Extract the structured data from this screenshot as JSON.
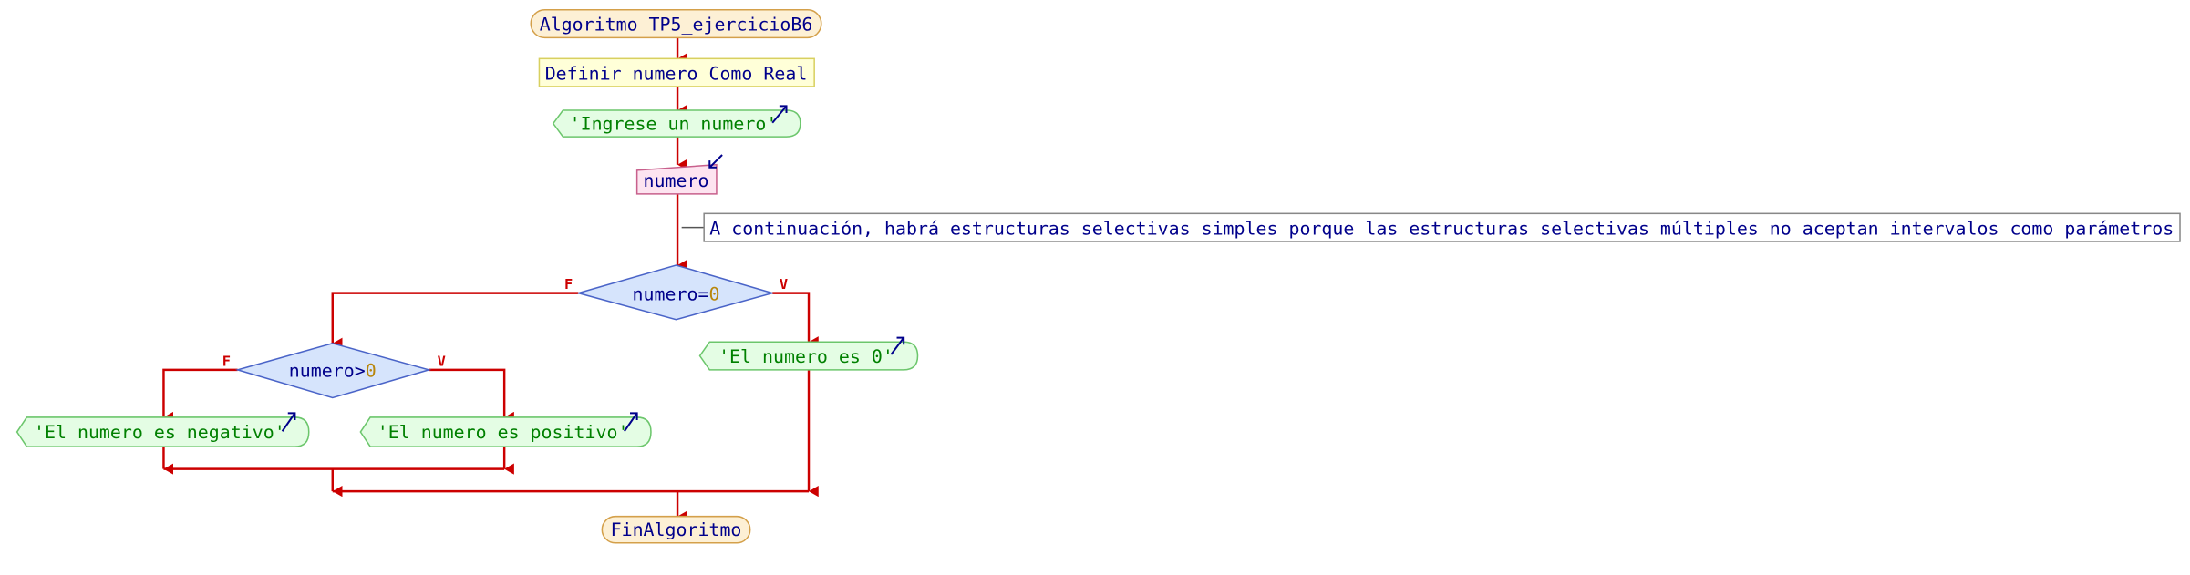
{
  "diagram": {
    "start": "Algoritmo TP5_ejercicioB6",
    "define": "Definir numero Como Real",
    "output_prompt": "'Ingrese un numero'",
    "input_var": "numero",
    "comment": "A continuación, habrá estructuras selectivas simples porque las estructuras selectivas múltiples no aceptan intervalos como parámetros",
    "decision1": {
      "var": "numero",
      "op": "=",
      "value": "0",
      "false_label": "F",
      "true_label": "V"
    },
    "decision2": {
      "var": "numero",
      "op": ">",
      "value": "0",
      "false_label": "F",
      "true_label": "V"
    },
    "output_zero": "'El numero es 0'",
    "output_negative": "'El numero es negativo'",
    "output_positive": "'El numero es positivo'",
    "end": "FinAlgoritmo"
  },
  "colors": {
    "flow": "#cc0000",
    "keyword": "#00008b",
    "string": "#008000",
    "number": "#b8860b"
  }
}
